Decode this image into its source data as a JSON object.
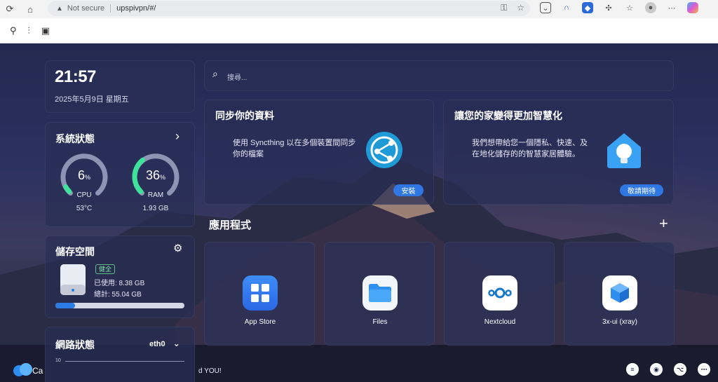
{
  "browser": {
    "security_label": "Not secure",
    "url": "upspivpn/#/"
  },
  "clock": {
    "time": "21:57",
    "date": "2025年5月9日 星期五"
  },
  "system_status": {
    "title": "系統狀態",
    "cpu": {
      "value": "6",
      "unit": "%",
      "label": "CPU",
      "sub": "53°C",
      "percent": 6
    },
    "ram": {
      "value": "36",
      "unit": "%",
      "label": "RAM",
      "sub": "1.93 GB",
      "percent": 36
    }
  },
  "storage": {
    "title": "儲存空間",
    "badge": "健全",
    "used": "已使用: 8.38 GB",
    "total": "總計: 55.04 GB",
    "used_fraction": 0.152
  },
  "network": {
    "title": "網路狀態",
    "interface": "eth0",
    "axis_top": "10"
  },
  "search": {
    "placeholder": "搜尋..."
  },
  "sync_card": {
    "title": "同步你的資料",
    "desc_line1": "使用 Syncthing 以在多個裝置間同步",
    "desc_line2": "你的檔案",
    "button": "安裝"
  },
  "home_card": {
    "title": "讓您的家變得更加智慧化",
    "desc_line1": "我們想帶給您一個隱私、快速、及",
    "desc_line2": "在地化儲存的的智慧家居體驗。",
    "button": "敬請期待"
  },
  "apps": {
    "title": "應用程式",
    "items": [
      {
        "name": "App Store"
      },
      {
        "name": "Files"
      },
      {
        "name": "Nextcloud"
      },
      {
        "name": "3x-ui (xray)"
      }
    ]
  },
  "footer": {
    "brand_fragment": "Ca",
    "message_fragment": "d YOU!"
  },
  "colors": {
    "accent": "#2f77e3",
    "gauge": "#3ee29a",
    "bg": "#1b2140"
  }
}
